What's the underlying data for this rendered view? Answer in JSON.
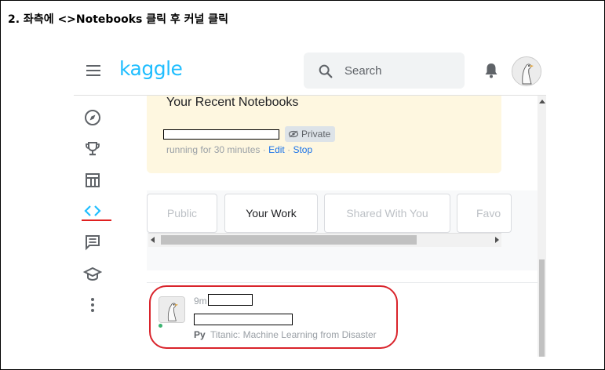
{
  "instruction": "2. 좌측에 <>Notebooks 클릭 후 커널 클릭",
  "header": {
    "logo": "kaggle",
    "search_placeholder": "Search"
  },
  "sidebar": {
    "items": [
      {
        "icon": "compass-icon"
      },
      {
        "icon": "trophy-icon"
      },
      {
        "icon": "table-icon"
      },
      {
        "icon": "code-icon",
        "active": true
      },
      {
        "icon": "comment-icon"
      },
      {
        "icon": "school-icon"
      },
      {
        "icon": "more-vert-icon"
      }
    ]
  },
  "recent": {
    "title": "Your Recent Notebooks",
    "badge": "Private",
    "running": "running for 30 minutes",
    "sep": " · ",
    "edit": "Edit",
    "stop": "Stop"
  },
  "tabs": [
    "Public",
    "Your Work",
    "Shared With You",
    "Favo"
  ],
  "active_tab": "Your Work",
  "notebook": {
    "time": "9m",
    "language": "Py",
    "competition": "Titanic: Machine Learning from Disaster"
  },
  "colors": {
    "accent": "#20beff",
    "highlight": "#d9232b",
    "recent_bg": "#fef7e0",
    "link": "#1a73e8"
  }
}
